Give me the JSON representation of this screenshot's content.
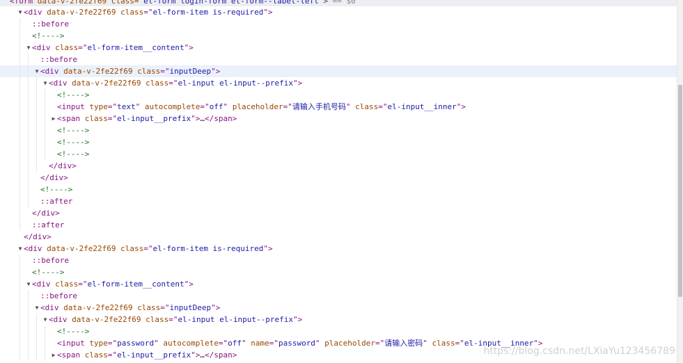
{
  "top_line": "<form data-v-2fe22f69 class=\"el-form login-form el-form--label-left\"> == $0",
  "top_line_parts": {
    "open": "<form",
    "attr1": " data-v-2fe22f69",
    "attr2": " class=",
    "val2": "\"el-form login-form el-form--label-left\"",
    "close": ">",
    "eq": " == $0"
  },
  "watermark": "https://blog.csdn.net/LXiaYu123456789",
  "dom_lines": [
    {
      "indent": 0,
      "toggle": "down",
      "type": "element",
      "tag": "div",
      "attrs": [
        {
          "name": "data-v-2fe22f69"
        },
        {
          "name": "class",
          "value": "el-form-item is-required"
        }
      ]
    },
    {
      "indent": 1,
      "type": "pseudo",
      "text": "::before"
    },
    {
      "indent": 1,
      "type": "comment",
      "text": "<!---->"
    },
    {
      "indent": 1,
      "toggle": "down",
      "type": "element",
      "tag": "div",
      "attrs": [
        {
          "name": "class",
          "value": "el-form-item__content"
        }
      ]
    },
    {
      "indent": 2,
      "type": "pseudo",
      "text": "::before"
    },
    {
      "indent": 2,
      "toggle": "down",
      "type": "element",
      "tag": "div",
      "highlight": true,
      "attrs": [
        {
          "name": "data-v-2fe22f69"
        },
        {
          "name": "class",
          "value": "inputDeep"
        }
      ]
    },
    {
      "indent": 3,
      "toggle": "down",
      "type": "element",
      "tag": "div",
      "attrs": [
        {
          "name": "data-v-2fe22f69"
        },
        {
          "name": "class",
          "value": "el-input el-input--prefix"
        }
      ]
    },
    {
      "indent": 4,
      "type": "comment",
      "text": "<!---->"
    },
    {
      "indent": 4,
      "type": "element",
      "tag": "input",
      "attrs": [
        {
          "name": "type",
          "value": "text"
        },
        {
          "name": "autocomplete",
          "value": "off"
        },
        {
          "name": "placeholder",
          "value": "请输入手机号码"
        },
        {
          "name": "class",
          "value": "el-input__inner"
        }
      ]
    },
    {
      "indent": 4,
      "toggle": "right",
      "type": "element",
      "tag": "span",
      "attrs": [
        {
          "name": "class",
          "value": "el-input__prefix"
        }
      ],
      "collapsed": "…",
      "close_tag": "span"
    },
    {
      "indent": 4,
      "type": "comment",
      "text": "<!---->"
    },
    {
      "indent": 4,
      "type": "comment",
      "text": "<!---->"
    },
    {
      "indent": 4,
      "type": "comment",
      "text": "<!---->"
    },
    {
      "indent": 3,
      "type": "close",
      "tag": "div"
    },
    {
      "indent": 2,
      "type": "close",
      "tag": "div"
    },
    {
      "indent": 2,
      "type": "comment",
      "text": "<!---->"
    },
    {
      "indent": 2,
      "type": "pseudo",
      "text": "::after"
    },
    {
      "indent": 1,
      "type": "close",
      "tag": "div"
    },
    {
      "indent": 1,
      "type": "pseudo",
      "text": "::after"
    },
    {
      "indent": 0,
      "type": "close",
      "tag": "div"
    },
    {
      "indent": 0,
      "toggle": "down",
      "type": "element",
      "tag": "div",
      "attrs": [
        {
          "name": "data-v-2fe22f69"
        },
        {
          "name": "class",
          "value": "el-form-item is-required"
        }
      ]
    },
    {
      "indent": 1,
      "type": "pseudo",
      "text": "::before"
    },
    {
      "indent": 1,
      "type": "comment",
      "text": "<!---->"
    },
    {
      "indent": 1,
      "toggle": "down",
      "type": "element",
      "tag": "div",
      "attrs": [
        {
          "name": "class",
          "value": "el-form-item__content"
        }
      ]
    },
    {
      "indent": 2,
      "type": "pseudo",
      "text": "::before"
    },
    {
      "indent": 2,
      "toggle": "down",
      "type": "element",
      "tag": "div",
      "attrs": [
        {
          "name": "data-v-2fe22f69"
        },
        {
          "name": "class",
          "value": "inputDeep"
        }
      ]
    },
    {
      "indent": 3,
      "toggle": "down",
      "type": "element",
      "tag": "div",
      "attrs": [
        {
          "name": "data-v-2fe22f69"
        },
        {
          "name": "class",
          "value": "el-input el-input--prefix"
        }
      ]
    },
    {
      "indent": 4,
      "type": "comment",
      "text": "<!---->"
    },
    {
      "indent": 4,
      "type": "element",
      "tag": "input",
      "attrs": [
        {
          "name": "type",
          "value": "password"
        },
        {
          "name": "autocomplete",
          "value": "off"
        },
        {
          "name": "name",
          "value": "password"
        },
        {
          "name": "placeholder",
          "value": "请输入密码"
        },
        {
          "name": "class",
          "value": "el-input__inner"
        }
      ]
    },
    {
      "indent": 4,
      "toggle": "right",
      "type": "element",
      "tag": "span",
      "attrs": [
        {
          "name": "class",
          "value": "el-input__prefix"
        }
      ],
      "collapsed": "…",
      "close_tag": "span"
    }
  ],
  "colors": {
    "tag": "#881280",
    "attr_name": "#994500",
    "attr_value": "#1a1aa6",
    "comment": "#236e25",
    "highlight_row": "#eaf1fb",
    "top_bar": "#eceef1"
  },
  "icons": {
    "expanded": "triangle-down-icon",
    "collapsed": "triangle-right-icon"
  }
}
